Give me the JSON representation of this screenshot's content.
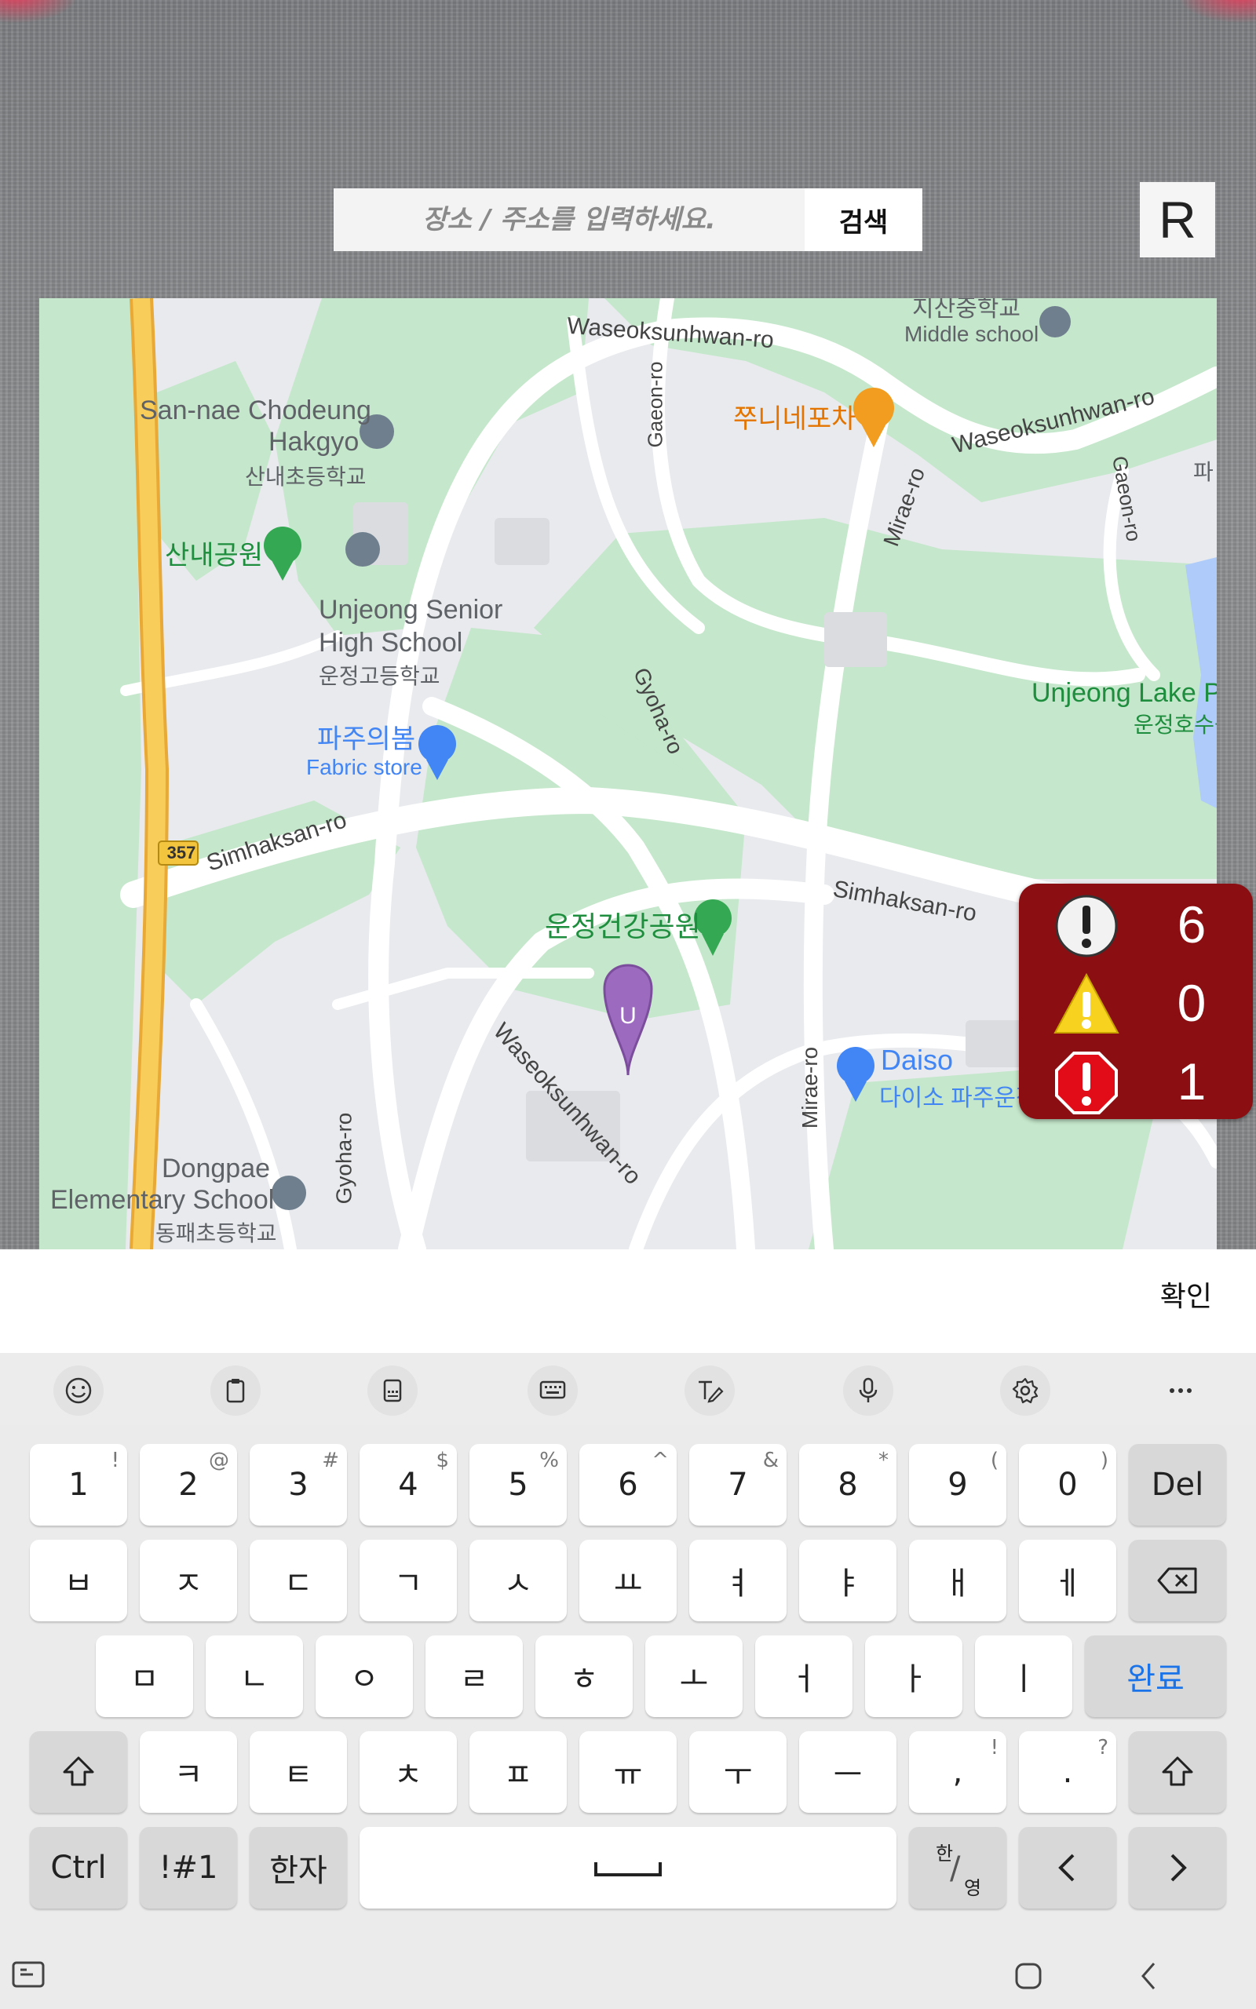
{
  "search": {
    "placeholder": "장소 / 주소를 입력하세요.",
    "button_label": "검색"
  },
  "reset_button_label": "R",
  "map": {
    "labels": {
      "waseoksunhwan_top": "Waseoksunhwan-ro",
      "middle_school_kr": "지산중학교",
      "middle_school_en": "Middle school",
      "jjuni": "쭈니네포차",
      "waseoksunhwan_right": "Waseoksunhwan-ro",
      "gaeon_top": "Gaeon-ro",
      "gaeon_right": "Gaeon-ro",
      "mirae_top": "Mirae-ro",
      "sannae_en1": "San-nae Chodeung",
      "sannae_en2": "Hakgyo",
      "sannae_kr": "산내초등학교",
      "sannae_park": "산내공원",
      "unjeong_high_en1": "Unjeong Senior",
      "unjeong_high_en2": "High School",
      "unjeong_high_kr": "운정고등학교",
      "gyoha_mid": "Gyoha-ro",
      "unjeong_lake_en": "Unjeong Lake Pa",
      "unjeong_lake_kr": "운정호수공",
      "fabric_kr": "파주의봄",
      "fabric_en": "Fabric store",
      "simhaksan_left": "Simhaksan-ro",
      "route_357": "357",
      "simhaksan_right": "Simhaksan-ro",
      "unjeong_park": "운정건강공원",
      "marker_u": "U",
      "waseoksunhwan_bottom": "Waseoksunhwan-ro",
      "mirae_bottom": "Mirae-ro",
      "daiso_en": "Daiso",
      "daiso_kr": "다이소 파주운정",
      "dongpae_en1": "Dongpae",
      "dongpae_en2": "Elementary School",
      "dongpae_kr": "동패초등학교",
      "gyoha_bottom": "Gyoha-ro",
      "pa_cut": "파"
    }
  },
  "alerts": {
    "info_count": "6",
    "warning_count": "0",
    "error_count": "1"
  },
  "confirm_label": "확인",
  "keyboard": {
    "row1": [
      {
        "main": "1",
        "sup": "!"
      },
      {
        "main": "2",
        "sup": "@"
      },
      {
        "main": "3",
        "sup": "#"
      },
      {
        "main": "4",
        "sup": "$"
      },
      {
        "main": "5",
        "sup": "%"
      },
      {
        "main": "6",
        "sup": "^"
      },
      {
        "main": "7",
        "sup": "&"
      },
      {
        "main": "8",
        "sup": "*"
      },
      {
        "main": "9",
        "sup": "("
      },
      {
        "main": "0",
        "sup": ")"
      }
    ],
    "del_label": "Del",
    "row2": [
      "ㅂ",
      "ㅈ",
      "ㄷ",
      "ㄱ",
      "ㅅ",
      "ㅛ",
      "ㅕ",
      "ㅑ",
      "ㅐ",
      "ㅔ"
    ],
    "row3": [
      "ㅁ",
      "ㄴ",
      "ㅇ",
      "ㄹ",
      "ㅎ",
      "ㅗ",
      "ㅓ",
      "ㅏ",
      "ㅣ"
    ],
    "done_label": "완료",
    "row4": [
      "ㅋ",
      "ㅌ",
      "ㅊ",
      "ㅍ",
      "ㅠ",
      "ㅜ",
      "ㅡ"
    ],
    "comma": {
      "main": ",",
      "sup": "!"
    },
    "period": {
      "main": ".",
      "sup": "?"
    },
    "ctrl_label": "Ctrl",
    "sym_label": "!#1",
    "hanja_label": "한자",
    "lang_top": "한",
    "lang_bottom": "영",
    "accent_color": "#1a73e8"
  },
  "colors": {
    "alert_panel": "#8b0f12",
    "map_green": "#c8e6c9",
    "highway": "#f6c143"
  }
}
